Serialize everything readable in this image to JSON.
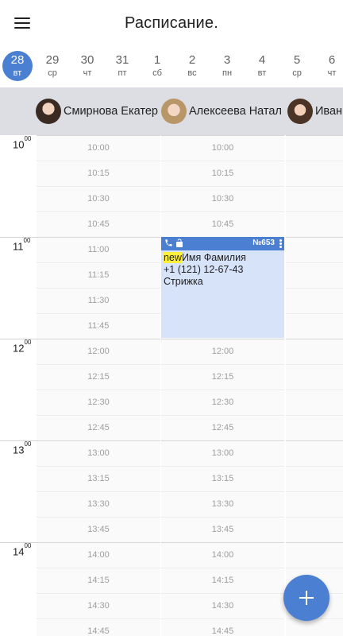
{
  "app": {
    "title": "Расписание."
  },
  "dates": [
    {
      "num": "28",
      "wd": "вт",
      "selected": true
    },
    {
      "num": "29",
      "wd": "ср"
    },
    {
      "num": "30",
      "wd": "чт"
    },
    {
      "num": "31",
      "wd": "пт"
    },
    {
      "num": "1",
      "wd": "сб"
    },
    {
      "num": "2",
      "wd": "вс"
    },
    {
      "num": "3",
      "wd": "пн"
    },
    {
      "num": "4",
      "wd": "вт"
    },
    {
      "num": "5",
      "wd": "ср"
    },
    {
      "num": "6",
      "wd": "чт"
    }
  ],
  "staff": [
    {
      "name": "Смирнова Екатерина",
      "visible": "Смирнова Екатер"
    },
    {
      "name": "Алексеева Наталья",
      "visible": "Алексеева Натал"
    },
    {
      "name": "Иван",
      "visible": "Иван"
    }
  ],
  "hours": [
    {
      "h": "10",
      "m": "00"
    },
    {
      "h": "11",
      "m": "00"
    },
    {
      "h": "12",
      "m": "00"
    },
    {
      "h": "13",
      "m": "00"
    },
    {
      "h": "14",
      "m": "00"
    }
  ],
  "slots": [
    "10:00",
    "10:15",
    "10:30",
    "10:45",
    "11:00",
    "11:15",
    "11:30",
    "11:45",
    "12:00",
    "12:15",
    "12:30",
    "12:45",
    "13:00",
    "13:15",
    "13:30",
    "13:45",
    "14:00",
    "14:15",
    "14:30",
    "14:45"
  ],
  "event": {
    "number": "№653",
    "tag": "new",
    "client": "Имя Фамилия",
    "phone": "+1 (121) 12-67-43",
    "service": "Стрижка"
  },
  "colors": {
    "accent": "#4a7fd1",
    "event_bg": "#d7e3f9",
    "tag_bg": "#fff03a"
  },
  "icons": {
    "menu": "menu-icon",
    "phone": "phone-icon",
    "lock": "unlock-icon",
    "more": "more-vertical-icon",
    "fab": "plus-icon"
  }
}
